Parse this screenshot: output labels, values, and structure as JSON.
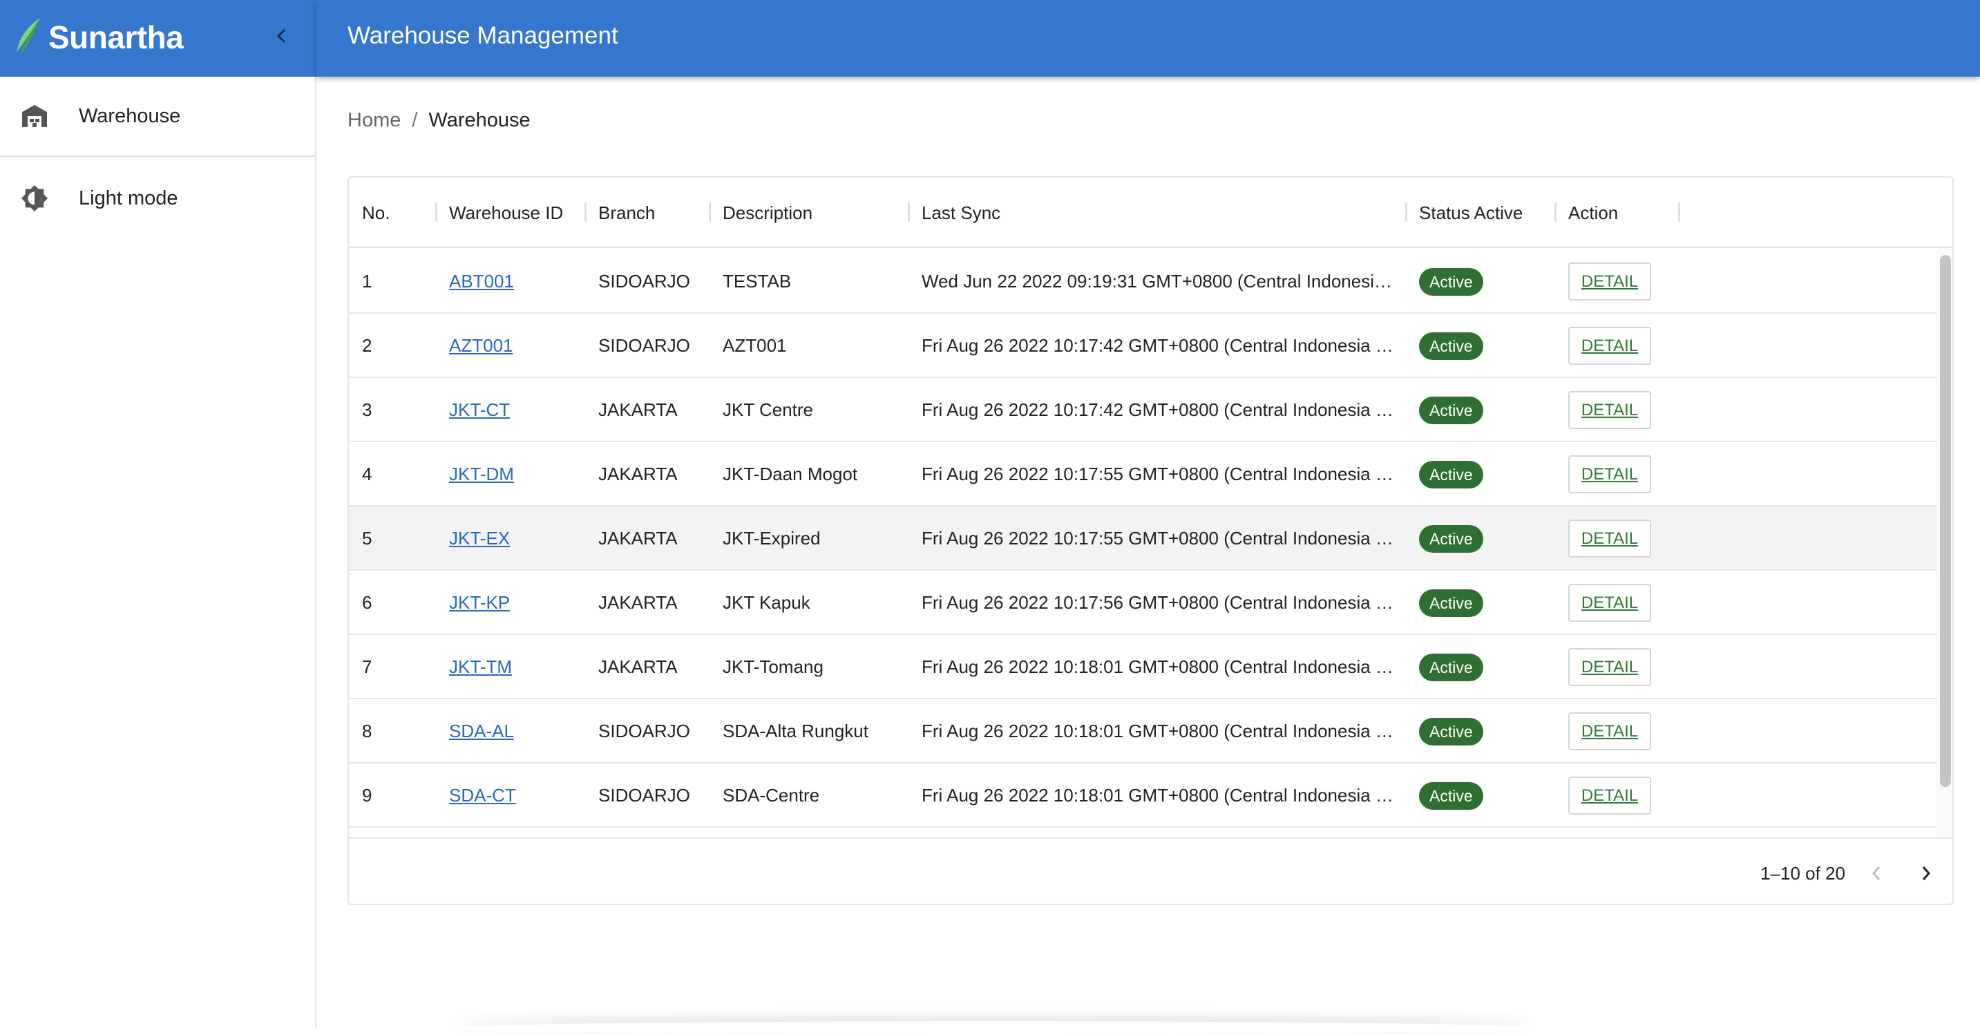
{
  "app": {
    "logo_text": "Sunartha",
    "header_title": "Warehouse Management"
  },
  "sidebar": {
    "items": [
      {
        "label": "Warehouse",
        "icon": "warehouse-icon"
      },
      {
        "label": "Light mode",
        "icon": "brightness-icon"
      }
    ]
  },
  "breadcrumb": {
    "home": "Home",
    "separator": "/",
    "current": "Warehouse"
  },
  "table": {
    "columns": [
      "No.",
      "Warehouse ID",
      "Branch",
      "Description",
      "Last Sync",
      "Status Active",
      "Action"
    ],
    "rows": [
      {
        "no": "1",
        "id": "ABT001",
        "branch": "SIDOARJO",
        "description": "TESTAB",
        "last_sync": "Wed Jun 22 2022 09:19:31 GMT+0800 (Central Indonesi…",
        "status": "Active",
        "action": "DETAIL"
      },
      {
        "no": "2",
        "id": "AZT001",
        "branch": "SIDOARJO",
        "description": "AZT001",
        "last_sync": "Fri Aug 26 2022 10:17:42 GMT+0800 (Central Indonesia …",
        "status": "Active",
        "action": "DETAIL"
      },
      {
        "no": "3",
        "id": "JKT-CT",
        "branch": "JAKARTA",
        "description": "JKT Centre",
        "last_sync": "Fri Aug 26 2022 10:17:42 GMT+0800 (Central Indonesia …",
        "status": "Active",
        "action": "DETAIL"
      },
      {
        "no": "4",
        "id": "JKT-DM",
        "branch": "JAKARTA",
        "description": "JKT-Daan Mogot",
        "last_sync": "Fri Aug 26 2022 10:17:55 GMT+0800 (Central Indonesia …",
        "status": "Active",
        "action": "DETAIL"
      },
      {
        "no": "5",
        "id": "JKT-EX",
        "branch": "JAKARTA",
        "description": "JKT-Expired",
        "last_sync": "Fri Aug 26 2022 10:17:55 GMT+0800 (Central Indonesia …",
        "status": "Active",
        "action": "DETAIL"
      },
      {
        "no": "6",
        "id": "JKT-KP",
        "branch": "JAKARTA",
        "description": "JKT Kapuk",
        "last_sync": "Fri Aug 26 2022 10:17:56 GMT+0800 (Central Indonesia …",
        "status": "Active",
        "action": "DETAIL"
      },
      {
        "no": "7",
        "id": "JKT-TM",
        "branch": "JAKARTA",
        "description": "JKT-Tomang",
        "last_sync": "Fri Aug 26 2022 10:18:01 GMT+0800 (Central Indonesia …",
        "status": "Active",
        "action": "DETAIL"
      },
      {
        "no": "8",
        "id": "SDA-AL",
        "branch": "SIDOARJO",
        "description": "SDA-Alta Rungkut",
        "last_sync": "Fri Aug 26 2022 10:18:01 GMT+0800 (Central Indonesia …",
        "status": "Active",
        "action": "DETAIL"
      },
      {
        "no": "9",
        "id": "SDA-CT",
        "branch": "SIDOARJO",
        "description": "SDA-Centre",
        "last_sync": "Fri Aug 26 2022 10:18:01 GMT+0800 (Central Indonesia …",
        "status": "Active",
        "action": "DETAIL"
      }
    ]
  },
  "pagination": {
    "text": "1–10 of 20"
  },
  "colors": {
    "brand_blue": "#3477cc",
    "active_badge": "#2f6f33",
    "link": "#2a66c4"
  }
}
